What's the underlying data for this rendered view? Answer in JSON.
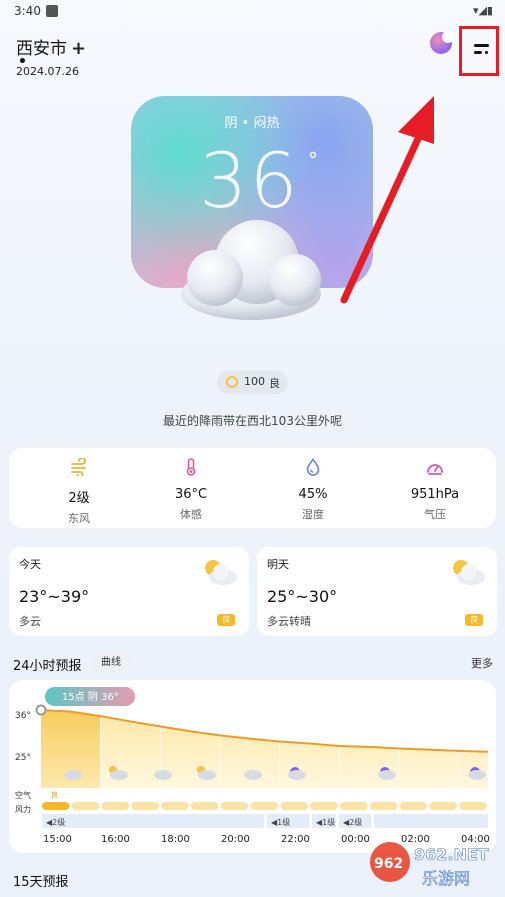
{
  "status_bar": {
    "time": "3:40",
    "right": "▾◢▮"
  },
  "header": {
    "city": "西安市",
    "add_symbol": "+",
    "date": "2024.07.26"
  },
  "hero": {
    "condition": "阴 • 闷热",
    "temperature": "36",
    "degree": "°"
  },
  "aqi": {
    "value": "100",
    "level": "良"
  },
  "rain_note": "最近的降雨带在西北103公里外呢",
  "stats": [
    {
      "value": "2级",
      "label": "东风",
      "icon": "wind-icon",
      "color": "#e9b43a"
    },
    {
      "value": "36°C",
      "label": "体感",
      "icon": "thermometer-icon",
      "color": "#e4579a"
    },
    {
      "value": "45%",
      "label": "湿度",
      "icon": "droplet-icon",
      "color": "#6d7ee8"
    },
    {
      "value": "951hPa",
      "label": "气压",
      "icon": "gauge-icon",
      "color": "#d85aa8"
    }
  ],
  "today": {
    "title": "今天",
    "range": "23°~39°",
    "condition": "多云",
    "badge": "良"
  },
  "tomorrow": {
    "title": "明天",
    "range": "25°~30°",
    "condition": "多云转晴",
    "badge": "良"
  },
  "hourly": {
    "title": "24小时预报",
    "tab": "曲线",
    "more": "更多",
    "tooltip": "15点 阴 36°",
    "y_labels": [
      "36°",
      "25°"
    ],
    "row_labels": [
      "空气",
      "风力"
    ],
    "aqi_badge": "良",
    "wind_segments": [
      "2级",
      "1级",
      "1级",
      "2级"
    ],
    "times": [
      "15:00",
      "16:00",
      "18:00",
      "20:00",
      "22:00",
      "00:00",
      "02:00",
      "04:00"
    ],
    "temps": [
      36,
      35.6,
      34.5,
      33.2,
      32,
      30.8,
      29.8,
      29,
      28.3,
      27.8,
      27.2,
      27,
      26.6,
      26.3,
      26,
      25.8
    ]
  },
  "forecast_15": {
    "title": "15天预报"
  },
  "watermark": {
    "line1": "962.NET",
    "line2": "乐游网"
  }
}
